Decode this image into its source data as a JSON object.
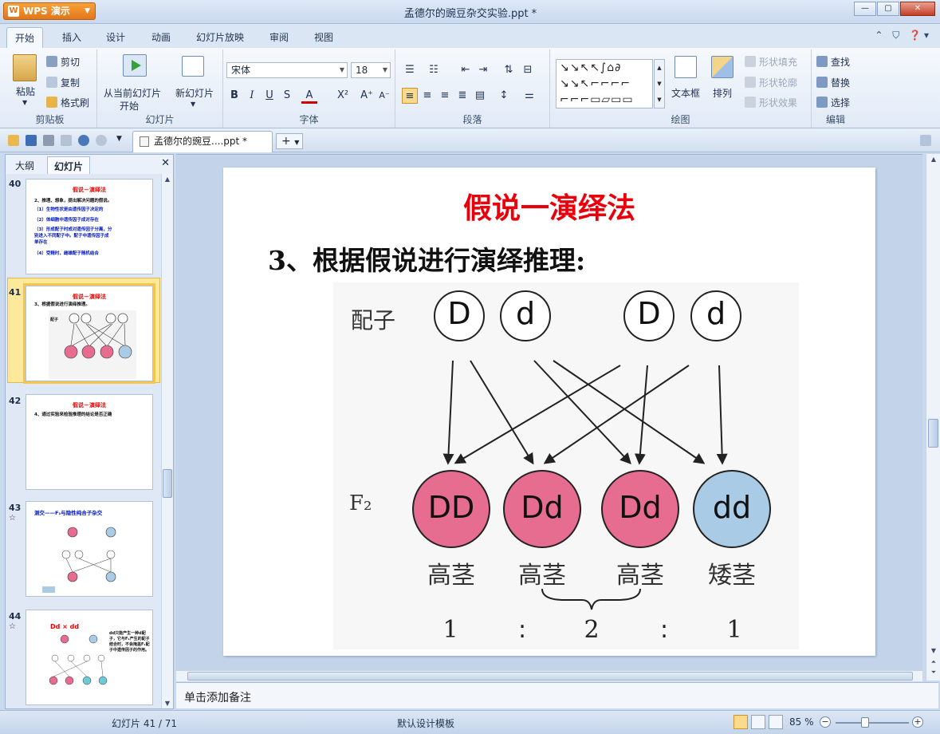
{
  "app": {
    "name": "WPS 演示",
    "title": "孟德尔的豌豆杂交实验.ppt *"
  },
  "ribbon_tabs": [
    "开始",
    "插入",
    "设计",
    "动画",
    "幻灯片放映",
    "审阅",
    "视图"
  ],
  "clipboard": {
    "paste": "粘贴",
    "cut": "剪切",
    "copy": "复制",
    "format_painter": "格式刷",
    "label": "剪贴板"
  },
  "slides_group": {
    "from_current": "从当前幻灯片",
    "from_current2": "开始",
    "new_slide": "新幻灯片",
    "label": "幻灯片"
  },
  "font_group": {
    "font_name": "宋体",
    "font_size": "18",
    "label": "字体"
  },
  "paragraph_group": {
    "label": "段落"
  },
  "drawing_group": {
    "textbox": "文本框",
    "arrange": "排列",
    "shape_fill": "形状填充",
    "shape_outline": "形状轮廓",
    "shape_effect": "形状效果",
    "label": "绘图"
  },
  "edit_group": {
    "find": "查找",
    "replace": "替换",
    "select": "选择",
    "label": "编辑"
  },
  "doc_tab": "孟德尔的豌豆....ppt *",
  "panel": {
    "tab_outline": "大纲",
    "tab_slides": "幻灯片",
    "thumbs": [
      {
        "num": "40",
        "title": "假说－演绎法",
        "lines": [
          "2、推理、想象，提出解决问题的假说。",
          "（1）生物性状是由遗传因子决定的",
          "（2）体细胞中遗传因子成对存在",
          "（3）形成配子时成对遗传因子分离，分",
          "别进入不同配子中。配子中遗传因子成",
          "单存在",
          "（4）受精时，雌雄配子随机结合"
        ]
      },
      {
        "num": "41",
        "title": "假说－演绎法",
        "lines": [
          "3、根据假说进行演绎推理。"
        ]
      },
      {
        "num": "42",
        "title": "假说－演绎法",
        "lines": [
          "4、通过实验来检验推理的结论是否正确"
        ]
      },
      {
        "num": "43",
        "title": "测交——F₁与隐性纯合子杂交",
        "lines": []
      },
      {
        "num": "44",
        "title": "Dd × dd",
        "lines": []
      }
    ]
  },
  "slide": {
    "title": "假说一演绎法",
    "subtitle": "3、根据假说进行演绎推理:",
    "figure": {
      "row1_label": "配子",
      "gametes": [
        "D",
        "d",
        "D",
        "d"
      ],
      "row2_label": "F₂",
      "offspring": [
        "DD",
        "Dd",
        "Dd",
        "dd"
      ],
      "phenotypes": [
        "高茎",
        "高茎",
        "高茎",
        "矮茎"
      ],
      "ratio": [
        "1",
        ":",
        "2",
        ":",
        "1"
      ]
    }
  },
  "notes_placeholder": "单击添加备注",
  "status": {
    "slide_pos": "幻灯片 41 / 71",
    "template": "默认设计模板",
    "zoom": "85 %"
  },
  "colors": {
    "pink": "#e66d8f",
    "blue": "#a9cbe6",
    "title_red": "#e8000b"
  }
}
